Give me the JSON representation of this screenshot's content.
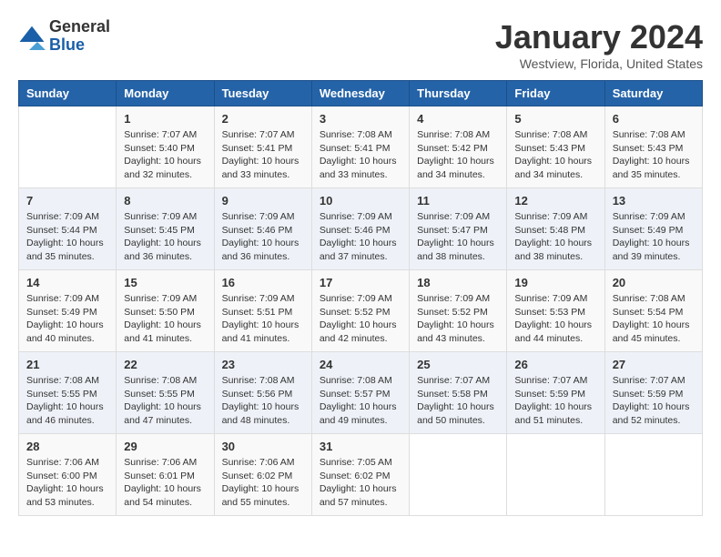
{
  "logo": {
    "line1": "General",
    "line2": "Blue"
  },
  "title": "January 2024",
  "location": "Westview, Florida, United States",
  "days_of_week": [
    "Sunday",
    "Monday",
    "Tuesday",
    "Wednesday",
    "Thursday",
    "Friday",
    "Saturday"
  ],
  "weeks": [
    [
      {
        "day": "",
        "info": ""
      },
      {
        "day": "1",
        "info": "Sunrise: 7:07 AM\nSunset: 5:40 PM\nDaylight: 10 hours\nand 32 minutes."
      },
      {
        "day": "2",
        "info": "Sunrise: 7:07 AM\nSunset: 5:41 PM\nDaylight: 10 hours\nand 33 minutes."
      },
      {
        "day": "3",
        "info": "Sunrise: 7:08 AM\nSunset: 5:41 PM\nDaylight: 10 hours\nand 33 minutes."
      },
      {
        "day": "4",
        "info": "Sunrise: 7:08 AM\nSunset: 5:42 PM\nDaylight: 10 hours\nand 34 minutes."
      },
      {
        "day": "5",
        "info": "Sunrise: 7:08 AM\nSunset: 5:43 PM\nDaylight: 10 hours\nand 34 minutes."
      },
      {
        "day": "6",
        "info": "Sunrise: 7:08 AM\nSunset: 5:43 PM\nDaylight: 10 hours\nand 35 minutes."
      }
    ],
    [
      {
        "day": "7",
        "info": "Sunrise: 7:09 AM\nSunset: 5:44 PM\nDaylight: 10 hours\nand 35 minutes."
      },
      {
        "day": "8",
        "info": "Sunrise: 7:09 AM\nSunset: 5:45 PM\nDaylight: 10 hours\nand 36 minutes."
      },
      {
        "day": "9",
        "info": "Sunrise: 7:09 AM\nSunset: 5:46 PM\nDaylight: 10 hours\nand 36 minutes."
      },
      {
        "day": "10",
        "info": "Sunrise: 7:09 AM\nSunset: 5:46 PM\nDaylight: 10 hours\nand 37 minutes."
      },
      {
        "day": "11",
        "info": "Sunrise: 7:09 AM\nSunset: 5:47 PM\nDaylight: 10 hours\nand 38 minutes."
      },
      {
        "day": "12",
        "info": "Sunrise: 7:09 AM\nSunset: 5:48 PM\nDaylight: 10 hours\nand 38 minutes."
      },
      {
        "day": "13",
        "info": "Sunrise: 7:09 AM\nSunset: 5:49 PM\nDaylight: 10 hours\nand 39 minutes."
      }
    ],
    [
      {
        "day": "14",
        "info": "Sunrise: 7:09 AM\nSunset: 5:49 PM\nDaylight: 10 hours\nand 40 minutes."
      },
      {
        "day": "15",
        "info": "Sunrise: 7:09 AM\nSunset: 5:50 PM\nDaylight: 10 hours\nand 41 minutes."
      },
      {
        "day": "16",
        "info": "Sunrise: 7:09 AM\nSunset: 5:51 PM\nDaylight: 10 hours\nand 41 minutes."
      },
      {
        "day": "17",
        "info": "Sunrise: 7:09 AM\nSunset: 5:52 PM\nDaylight: 10 hours\nand 42 minutes."
      },
      {
        "day": "18",
        "info": "Sunrise: 7:09 AM\nSunset: 5:52 PM\nDaylight: 10 hours\nand 43 minutes."
      },
      {
        "day": "19",
        "info": "Sunrise: 7:09 AM\nSunset: 5:53 PM\nDaylight: 10 hours\nand 44 minutes."
      },
      {
        "day": "20",
        "info": "Sunrise: 7:08 AM\nSunset: 5:54 PM\nDaylight: 10 hours\nand 45 minutes."
      }
    ],
    [
      {
        "day": "21",
        "info": "Sunrise: 7:08 AM\nSunset: 5:55 PM\nDaylight: 10 hours\nand 46 minutes."
      },
      {
        "day": "22",
        "info": "Sunrise: 7:08 AM\nSunset: 5:55 PM\nDaylight: 10 hours\nand 47 minutes."
      },
      {
        "day": "23",
        "info": "Sunrise: 7:08 AM\nSunset: 5:56 PM\nDaylight: 10 hours\nand 48 minutes."
      },
      {
        "day": "24",
        "info": "Sunrise: 7:08 AM\nSunset: 5:57 PM\nDaylight: 10 hours\nand 49 minutes."
      },
      {
        "day": "25",
        "info": "Sunrise: 7:07 AM\nSunset: 5:58 PM\nDaylight: 10 hours\nand 50 minutes."
      },
      {
        "day": "26",
        "info": "Sunrise: 7:07 AM\nSunset: 5:59 PM\nDaylight: 10 hours\nand 51 minutes."
      },
      {
        "day": "27",
        "info": "Sunrise: 7:07 AM\nSunset: 5:59 PM\nDaylight: 10 hours\nand 52 minutes."
      }
    ],
    [
      {
        "day": "28",
        "info": "Sunrise: 7:06 AM\nSunset: 6:00 PM\nDaylight: 10 hours\nand 53 minutes."
      },
      {
        "day": "29",
        "info": "Sunrise: 7:06 AM\nSunset: 6:01 PM\nDaylight: 10 hours\nand 54 minutes."
      },
      {
        "day": "30",
        "info": "Sunrise: 7:06 AM\nSunset: 6:02 PM\nDaylight: 10 hours\nand 55 minutes."
      },
      {
        "day": "31",
        "info": "Sunrise: 7:05 AM\nSunset: 6:02 PM\nDaylight: 10 hours\nand 57 minutes."
      },
      {
        "day": "",
        "info": ""
      },
      {
        "day": "",
        "info": ""
      },
      {
        "day": "",
        "info": ""
      }
    ]
  ]
}
